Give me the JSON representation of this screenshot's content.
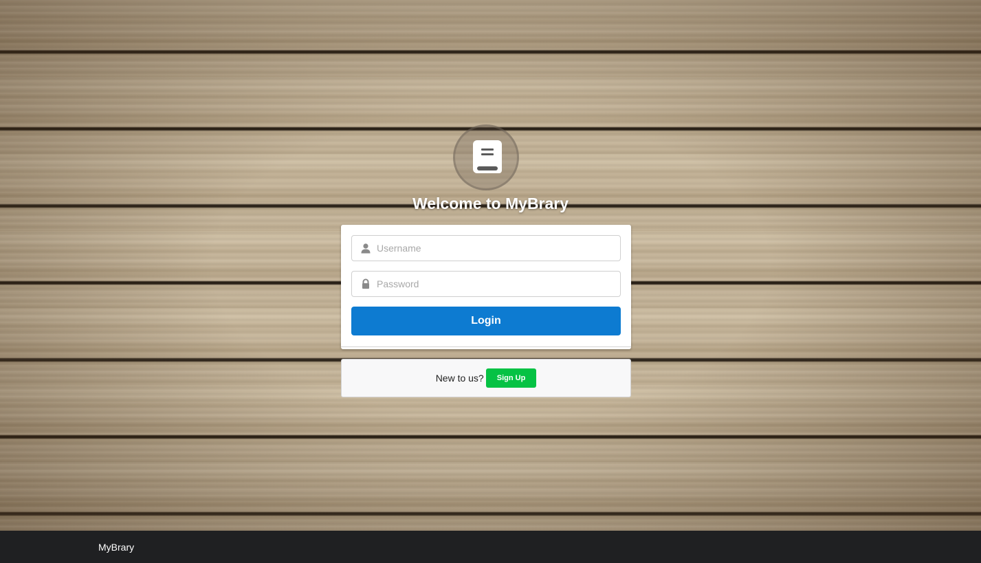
{
  "app": {
    "title": "Welcome to MyBrary",
    "logo_icon": "book-icon"
  },
  "login_form": {
    "username_placeholder": "Username",
    "username_icon": "user-icon",
    "password_placeholder": "Password",
    "password_icon": "lock-icon",
    "login_label": "Login"
  },
  "signup": {
    "prompt": "New to us?",
    "button_label": "Sign Up"
  },
  "footer": {
    "brand": "MyBrary"
  },
  "colors": {
    "primary_button": "#0d7bd1",
    "signup_button": "#06c244",
    "footer_bg": "#1f2022"
  }
}
